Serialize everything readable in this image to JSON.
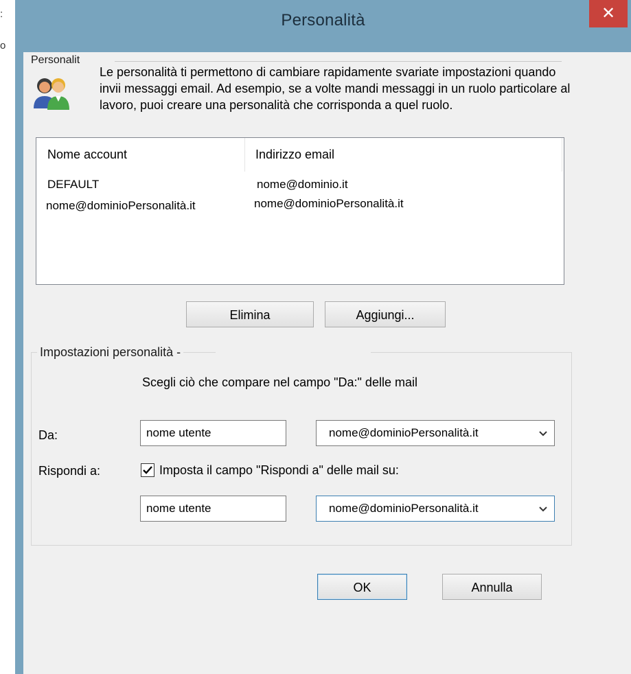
{
  "window": {
    "title": "Personalità"
  },
  "background": {
    "chars": [
      ":",
      "o"
    ]
  },
  "personality_group": {
    "label": "Personalit",
    "description": "Le personalità ti permettono di cambiare rapidamente svariate impostazioni quando invii messaggi email. Ad esempio, se a volte mandi messaggi in un ruolo particolare al lavoro, puoi creare una personalità che corrisponda a quel ruolo.",
    "icon": "people-icon"
  },
  "accounts_list": {
    "columns": [
      "Nome account",
      "Indirizzo email"
    ],
    "rows": [
      {
        "name": "DEFAULT",
        "email": "nome@dominio.it"
      },
      {
        "name": "nome@dominioPersonalità.it",
        "email": "nome@dominioPersonalità.it"
      }
    ]
  },
  "list_buttons": {
    "delete": "Elimina",
    "add": "Aggiungi..."
  },
  "settings_group": {
    "label": "Impostazioni personalità -",
    "instruction": "Scegli ciò che compare nel campo \"Da:\" delle mail",
    "from_label": "Da:",
    "from_name": "nome utente",
    "from_email": "nome@dominioPersonalità.it",
    "reply_label": "Rispondi a:",
    "reply_checkbox_label": "Imposta il campo \"Rispondi a\" delle mail su:",
    "reply_checked": true,
    "reply_name": "nome utente",
    "reply_email": "nome@dominioPersonalità.it"
  },
  "dialog_buttons": {
    "ok": "OK",
    "cancel": "Annulla"
  },
  "colors": {
    "titlebar": "#78a4be",
    "close_button": "#c8433c",
    "client_background": "#f0f0f0",
    "focus_border": "#3c7fb1"
  }
}
